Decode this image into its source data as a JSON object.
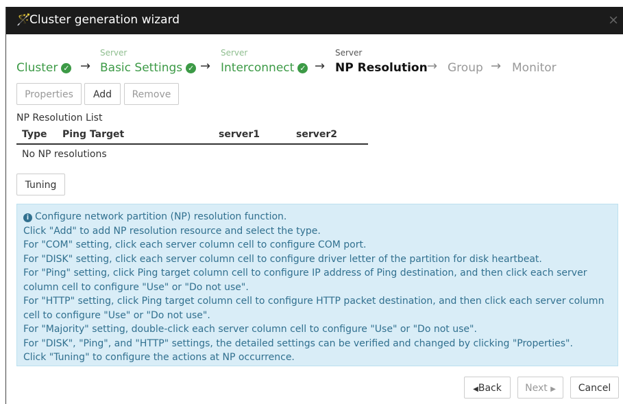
{
  "window": {
    "title": "Cluster generation wizard",
    "wand_icon": "magic-wand-icon",
    "close_icon": "×"
  },
  "steps": [
    {
      "sub": "",
      "label": "Cluster",
      "state": "done"
    },
    {
      "sub": "Server",
      "label": "Basic Settings",
      "state": "done"
    },
    {
      "sub": "Server",
      "label": "Interconnect",
      "state": "done"
    },
    {
      "sub": "Server",
      "label": "NP Resolution",
      "state": "current"
    },
    {
      "sub": "",
      "label": "Group",
      "state": "todo"
    },
    {
      "sub": "",
      "label": "Monitor",
      "state": "todo"
    }
  ],
  "toolbar": {
    "properties_label": "Properties",
    "add_label": "Add",
    "remove_label": "Remove"
  },
  "list": {
    "title": "NP Resolution List",
    "columns": [
      "Type",
      "Ping Target",
      "server1",
      "server2"
    ],
    "empty_text": "No NP resolutions"
  },
  "tuning_label": "Tuning",
  "info_lines": [
    "Configure network partition (NP) resolution function.",
    "Click \"Add\" to add NP resolution resource and select the type.",
    "For \"COM\" setting, click each server column cell to configure COM port.",
    "For \"DISK\" setting, click each server column cell to configure driver letter of the partition for disk heartbeat.",
    "For \"Ping\" setting, click Ping target column cell to configure IP address of Ping destination, and then click each server column cell to configure \"Use\" or \"Do not use\".",
    "For \"HTTP\" setting, click Ping target column cell to configure HTTP packet destination, and then click each server column cell to configure \"Use\" or \"Do not use\".",
    "For \"Majority\" setting, double-click each server column cell to configure \"Use\" or \"Do not use\".",
    "For \"DISK\", \"Ping\", and \"HTTP\" settings, the detailed settings can be verified and changed by clicking \"Properties\".",
    "Click \"Tuning\" to configure the actions at NP occurrence."
  ],
  "footer": {
    "back_label": "Back",
    "next_label": "Next",
    "cancel_label": "Cancel"
  },
  "colors": {
    "done": "#3c9a46",
    "info_bg": "#d9edf7",
    "info_text": "#31708f",
    "titlebar": "#1b1b1b"
  }
}
